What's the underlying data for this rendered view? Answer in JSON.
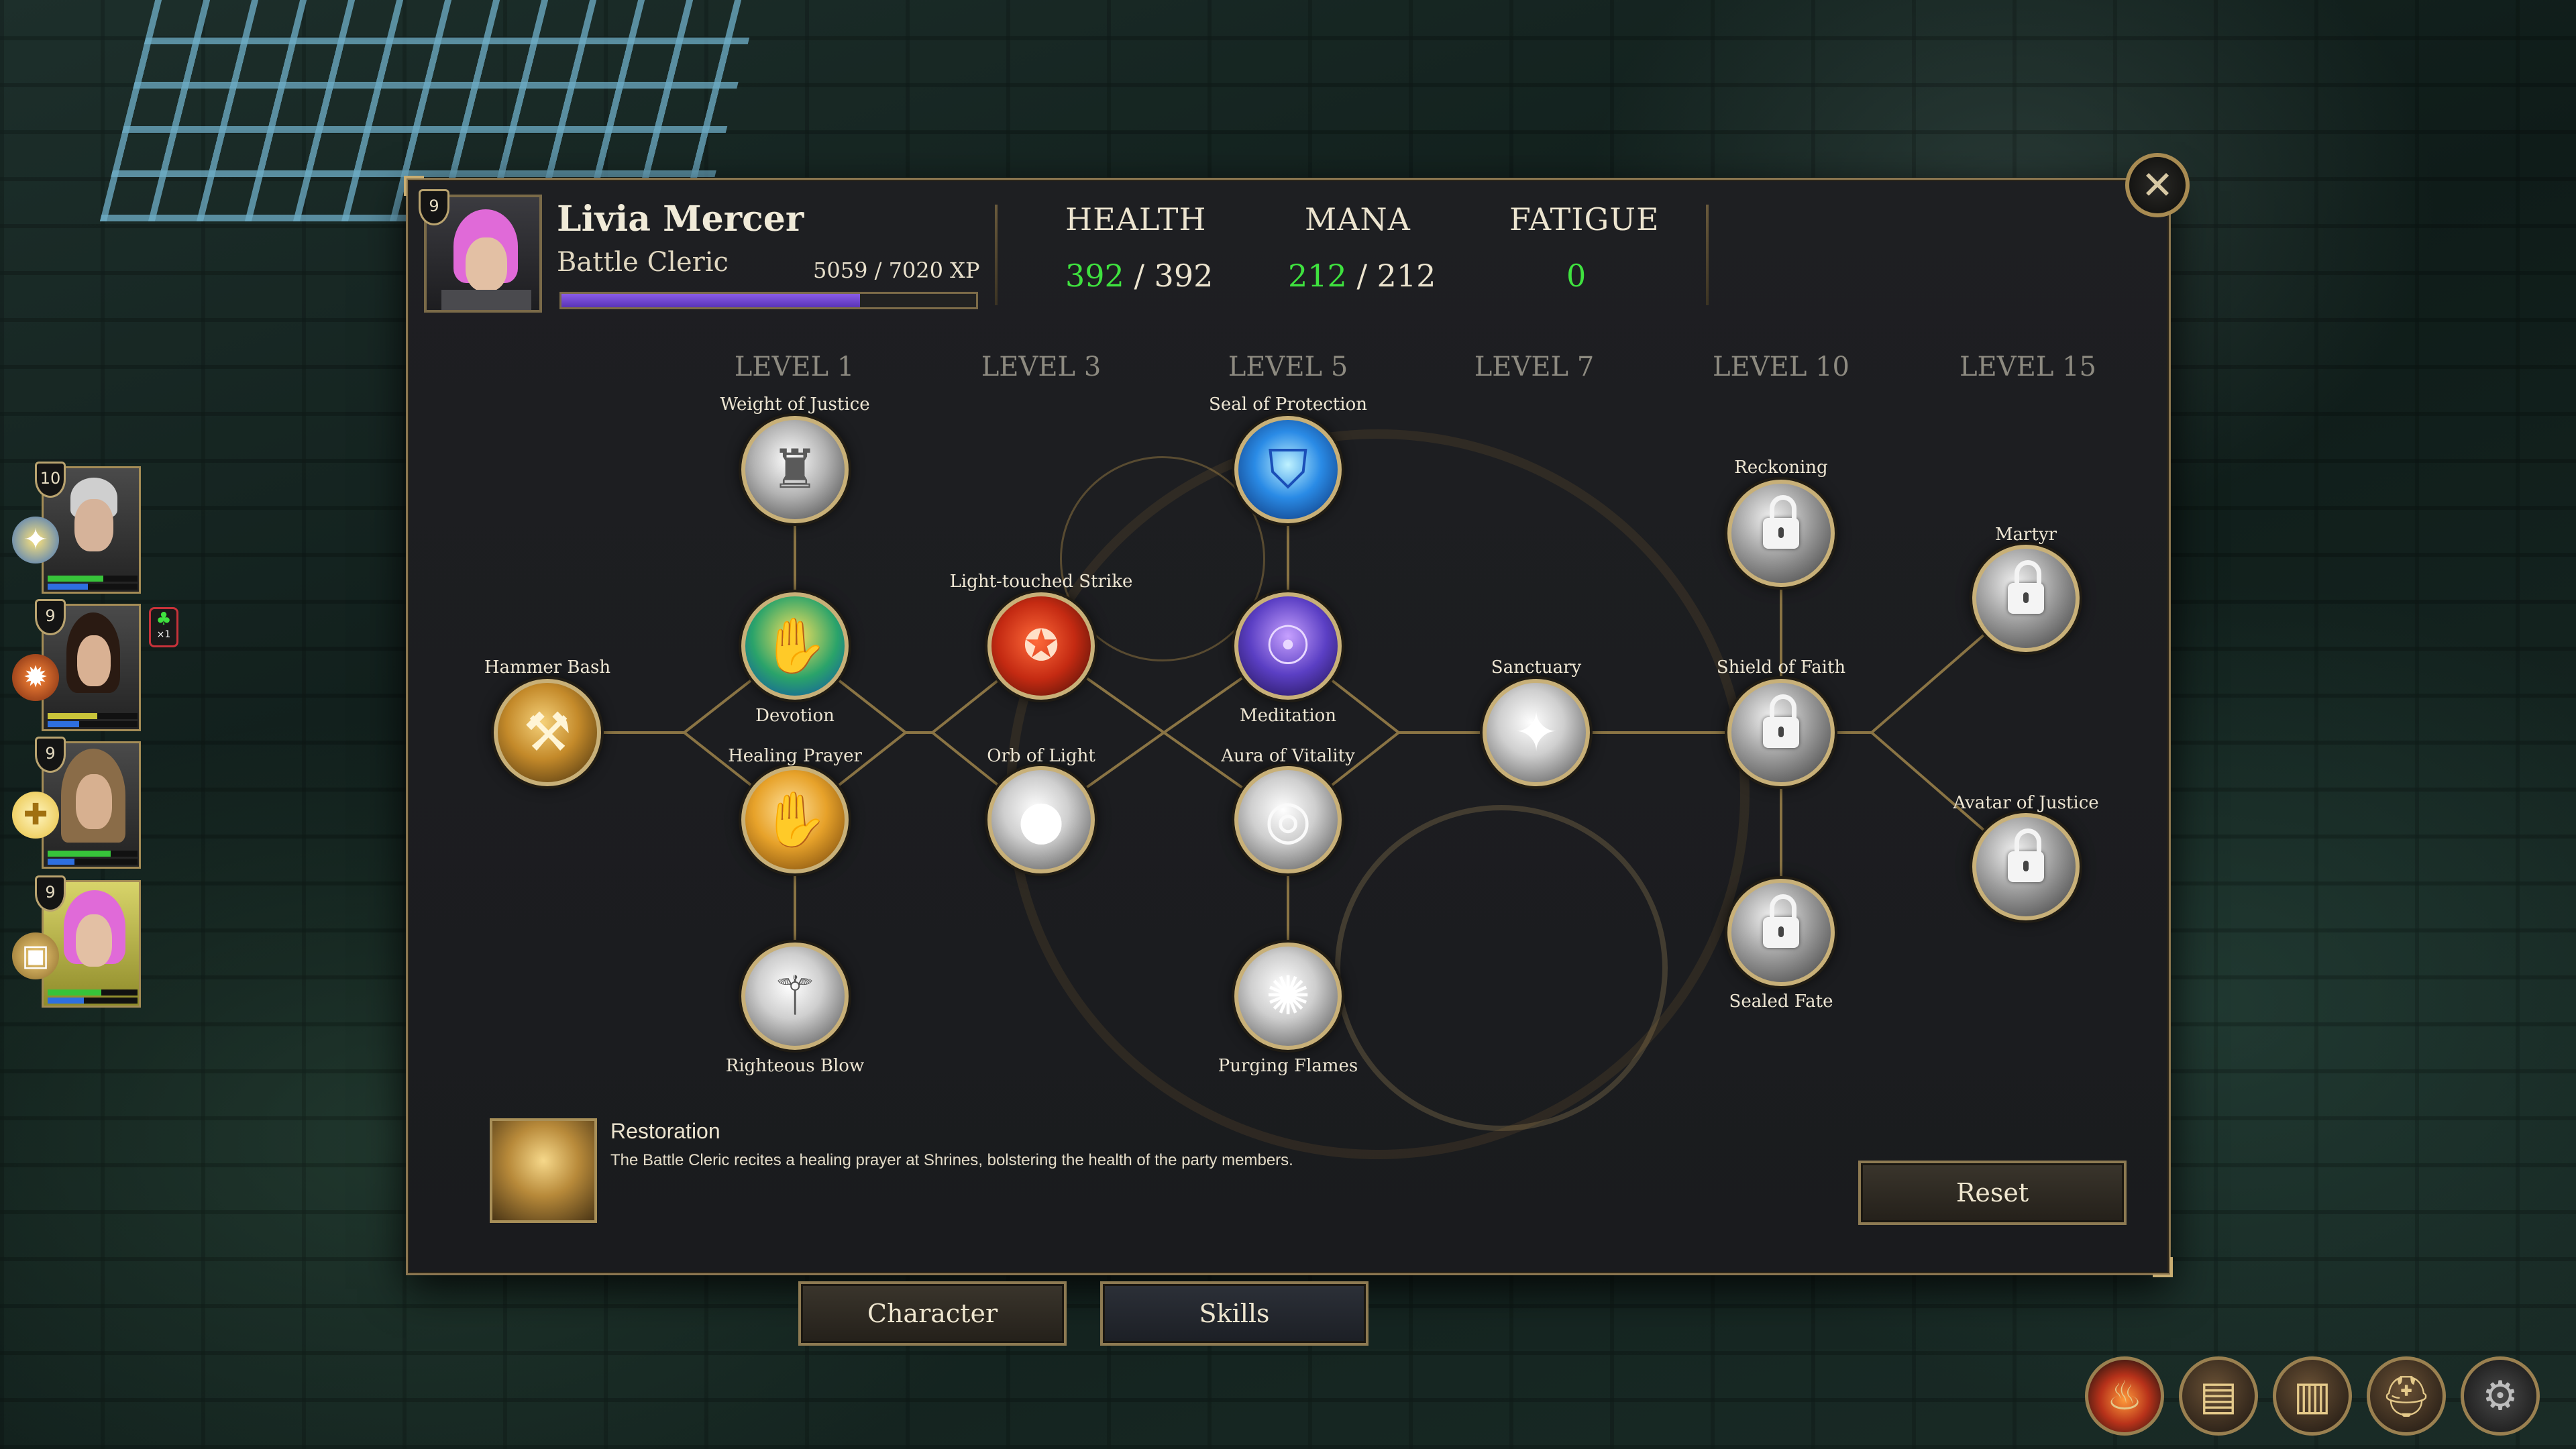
{
  "character": {
    "name": "Livia Mercer",
    "class": "Battle Cleric",
    "level": "9",
    "xp_text": "5059 / 7020 XP",
    "xp_fraction": 0.72
  },
  "stats": {
    "health": {
      "label": "HEALTH",
      "current": "392",
      "sep": "/ 392"
    },
    "mana": {
      "label": "MANA",
      "current": "212",
      "sep": "/ 212"
    },
    "fatigue": {
      "label": "FATIGUE",
      "value": "0"
    }
  },
  "level_headers": [
    "LEVEL 1",
    "LEVEL 3",
    "LEVEL 5",
    "LEVEL 7",
    "LEVEL 10",
    "LEVEL 15"
  ],
  "skills": {
    "hammer_bash": "Hammer Bash",
    "weight_of_justice": "Weight of Justice",
    "devotion": "Devotion",
    "healing_prayer": "Healing Prayer",
    "righteous_blow": "Righteous Blow",
    "light_touched_strike": "Light-touched Strike",
    "orb_of_light": "Orb of Light",
    "seal_of_protection": "Seal of Protection",
    "meditation": "Meditation",
    "aura_of_vitality": "Aura of Vitality",
    "purging_flames": "Purging Flames",
    "sanctuary": "Sanctuary",
    "reckoning": "Reckoning",
    "shield_of_faith": "Shield of Faith",
    "sealed_fate": "Sealed Fate",
    "martyr": "Martyr",
    "avatar_of_justice": "Avatar of Justice"
  },
  "description": {
    "title": "Restoration",
    "text": "The Battle Cleric recites a healing prayer at Shrines, bolstering the health of the party members."
  },
  "buttons": {
    "reset": "Reset",
    "character": "Character",
    "skills": "Skills",
    "close_glyph": "✕"
  },
  "party": [
    {
      "level": "10",
      "health": 0.62,
      "mana": 0.45
    },
    {
      "level": "9",
      "health": 0.55,
      "mana": 0.35,
      "status": "×1"
    },
    {
      "level": "9",
      "health": 0.7,
      "mana": 0.3
    },
    {
      "level": "9",
      "health": 0.6,
      "mana": 0.4
    }
  ],
  "icons": {
    "close": "close-icon",
    "lock": "lock-icon",
    "toolbar": [
      "campfire-icon",
      "backpack-icon",
      "spellbook-icon",
      "helmet-icon",
      "gear-icon"
    ]
  },
  "colors": {
    "accent": "#c8b078",
    "health_value": "#3fe23f",
    "xp_bar": "#7a4ed6"
  }
}
